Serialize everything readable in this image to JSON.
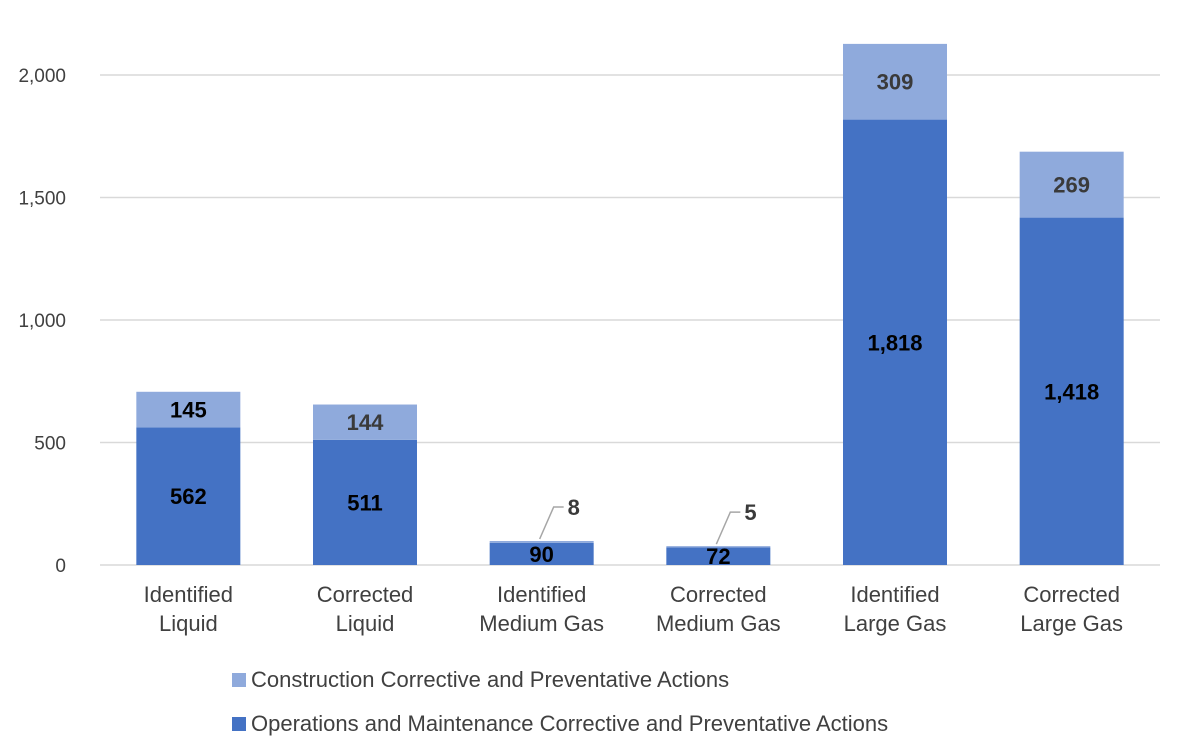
{
  "chart_data": {
    "type": "bar",
    "stacked": true,
    "title": "",
    "xlabel": "",
    "ylabel": "",
    "ylim": [
      0,
      2000
    ],
    "yticks": [
      0,
      500,
      1000,
      1500,
      2000
    ],
    "ytick_labels": [
      "0",
      "500",
      "1,000",
      "1,500",
      "2,000"
    ],
    "grid": true,
    "legend_position": "bottom",
    "categories": [
      [
        "Identified",
        "Liquid"
      ],
      [
        "Corrected",
        "Liquid"
      ],
      [
        "Identified",
        "Medium Gas"
      ],
      [
        "Corrected",
        "Medium Gas"
      ],
      [
        "Identified",
        "Large Gas"
      ],
      [
        "Corrected",
        "Large Gas"
      ]
    ],
    "series": [
      {
        "name": "Operations and Maintenance Corrective and Preventative Actions",
        "color": "#4472C4",
        "values": [
          562,
          511,
          90,
          72,
          1818,
          1418
        ],
        "labels": [
          "562",
          "511",
          "90",
          "72",
          "1,818",
          "1,418"
        ]
      },
      {
        "name": "Construction Corrective and Preventative Actions",
        "color": "#8FAADC",
        "values": [
          145,
          144,
          8,
          5,
          309,
          269
        ],
        "labels": [
          "145",
          "144",
          "8",
          "5",
          "309",
          "269"
        ]
      }
    ]
  },
  "legend": [
    {
      "label": "Construction Corrective and Preventative Actions",
      "color": "#8FAADC"
    },
    {
      "label": "Operations and Maintenance Corrective and Preventative Actions",
      "color": "#4472C4"
    }
  ]
}
